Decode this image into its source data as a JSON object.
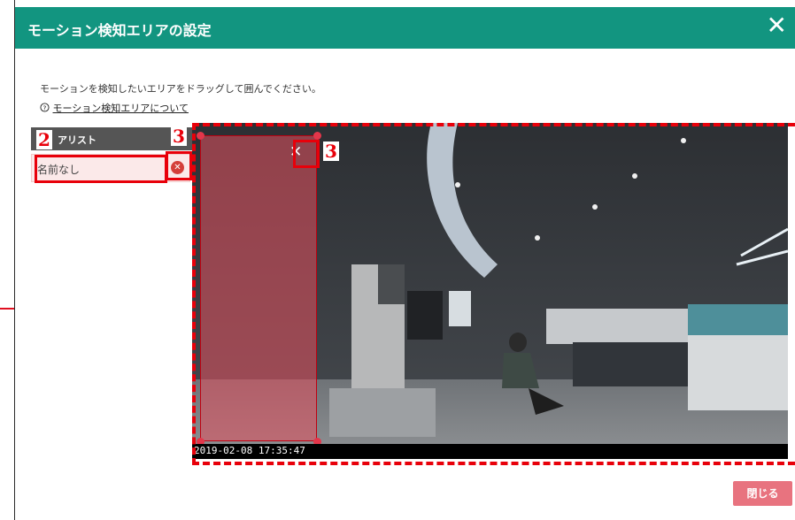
{
  "dialog": {
    "title": "モーション検知エリアの設定",
    "close_glyph": "✕"
  },
  "instructions": "モーションを検知したいエリアをドラッグして囲んでください。",
  "help": {
    "icon": "?",
    "link_text": "モーション検知エリアについて"
  },
  "area_list": {
    "header_label": "アリスト",
    "count": "1",
    "items": [
      {
        "name": "名前なし"
      }
    ]
  },
  "video": {
    "timestamp": "2019-02-08  17:35:47"
  },
  "zone": {
    "close_glyph": "✕"
  },
  "annotations": {
    "badge_2": "2",
    "badge_3a": "3",
    "badge_3b": "3"
  },
  "footer": {
    "close_button": "閉じる"
  },
  "colors": {
    "titlebar": "#129580",
    "annotation_red": "#e8000a",
    "close_button": "#e8737f",
    "zone_fill": "#e6505f"
  },
  "icons": [
    "close-icon",
    "help-circle-icon",
    "delete-circle-icon",
    "arrow-right-icon"
  ]
}
